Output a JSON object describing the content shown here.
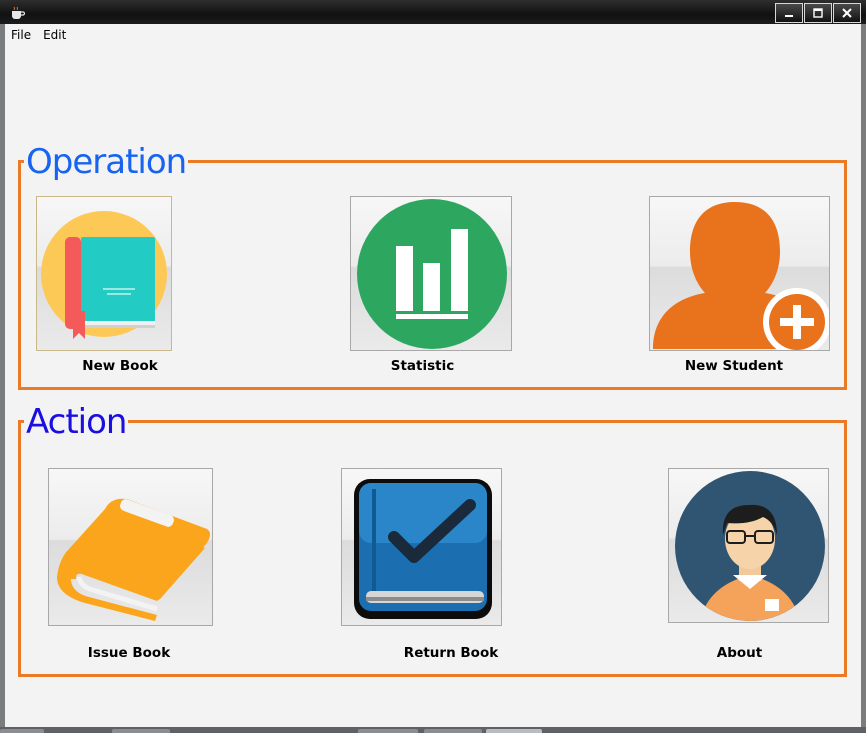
{
  "menu": {
    "file": "File",
    "edit": "Edit"
  },
  "operation": {
    "title": "Operation",
    "title_color": "#1764f0",
    "items": [
      {
        "label": "New Book",
        "icon": "book-icon"
      },
      {
        "label": "Statistic",
        "icon": "bar-chart-icon"
      },
      {
        "label": "New Student",
        "icon": "add-user-icon"
      }
    ]
  },
  "action": {
    "title": "Action",
    "title_color": "#1a0ee0",
    "items": [
      {
        "label": "Issue Book",
        "icon": "book-icon"
      },
      {
        "label": "Return Book",
        "icon": "checkmark-book-icon"
      },
      {
        "label": "About",
        "icon": "person-avatar-icon"
      }
    ]
  },
  "colors": {
    "border": "#ea7a24",
    "background": "#f3f3f3"
  }
}
